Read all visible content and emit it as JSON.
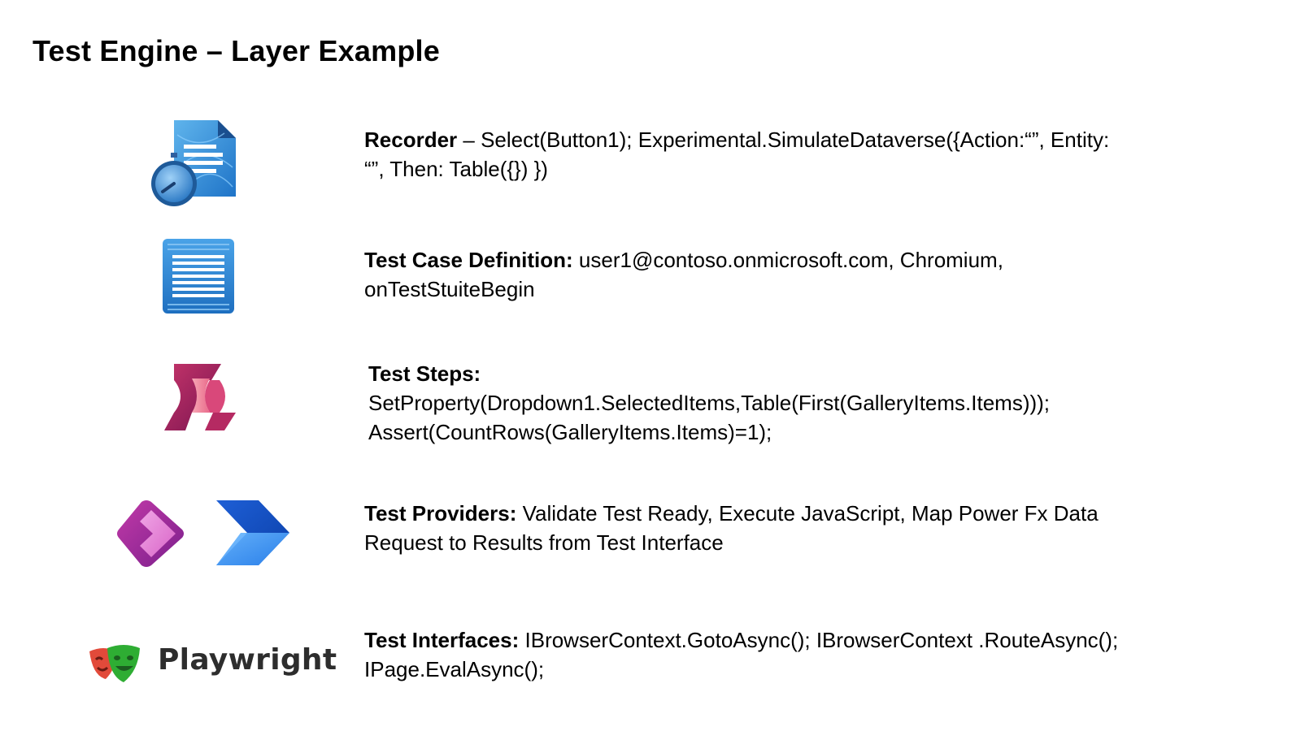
{
  "title": "Test Engine – Layer Example",
  "layers": [
    {
      "icon": "recorder-icon",
      "label": "Recorder",
      "separator": " – ",
      "lines": [
        "Select(Button1); Experimental.SimulateDataverse({Action:“”, Entity:",
        "“”, Then: Table({}) })"
      ]
    },
    {
      "icon": "document-icon",
      "label": "Test Case Definition:",
      "separator": " ",
      "lines": [
        "user1@contoso.onmicrosoft.com, Chromium,",
        "onTestStuiteBegin"
      ]
    },
    {
      "icon": "power-fx-icon",
      "label": "Test Steps:",
      "lines": [
        "SetProperty(Dropdown1.SelectedItems,Table(First(GalleryItems.Items)));",
        "Assert(CountRows(GalleryItems.Items)=1);"
      ]
    },
    {
      "icons": [
        "power-apps-icon",
        "power-automate-icon"
      ],
      "label": "Test Providers:",
      "separator": " ",
      "lines": [
        "Validate Test Ready, Execute JavaScript, Map Power Fx Data",
        "Request to Results from Test Interface"
      ]
    },
    {
      "icon": "playwright-icon",
      "brand_label": "Playwright",
      "label": "Test Interfaces:",
      "separator": " ",
      "lines": [
        "IBrowserContext.GotoAsync(); IBrowserContext .RouteAsync();",
        "IPage.EvalAsync();"
      ]
    }
  ]
}
